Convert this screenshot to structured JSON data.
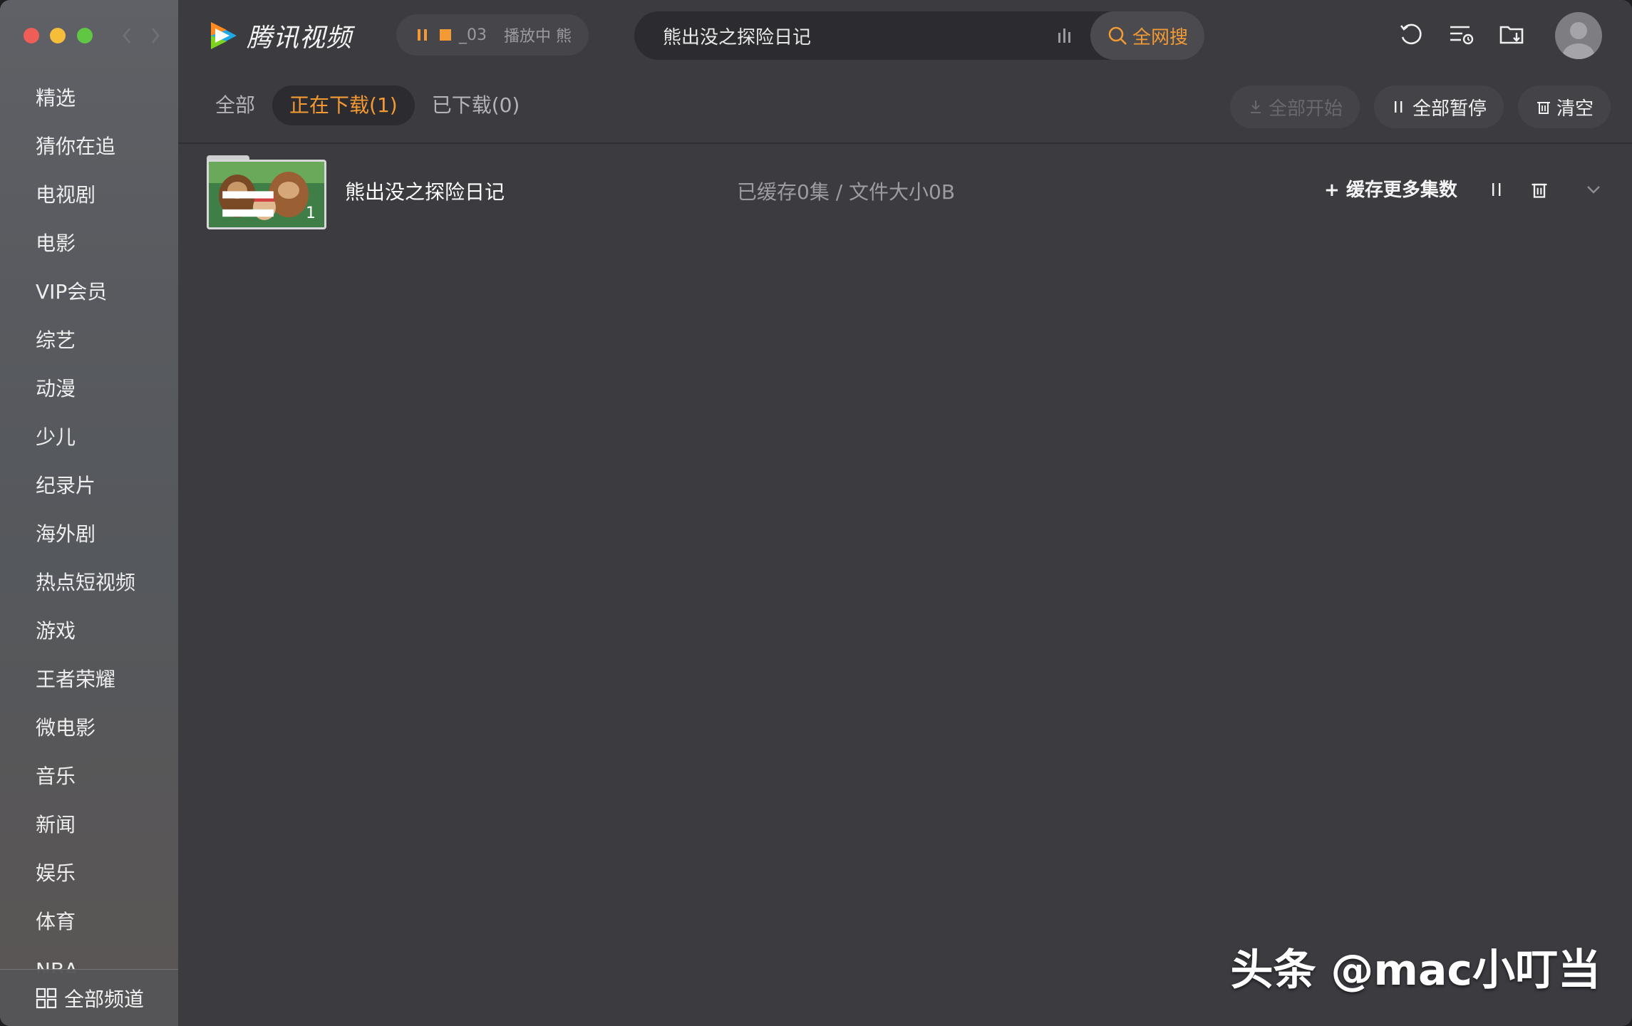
{
  "colors": {
    "accent": "#f39a34",
    "sidebar_bg": "#5b5d61",
    "main_bg": "#3b3b40",
    "traffic_red": "#ee5e57",
    "traffic_yellow": "#f5bd3a",
    "traffic_green": "#5fc744"
  },
  "app": {
    "name": "腾讯视频"
  },
  "sidebar": {
    "items": [
      {
        "label": "精选"
      },
      {
        "label": "猜你在追"
      },
      {
        "label": "电视剧"
      },
      {
        "label": "电影"
      },
      {
        "label": "VIP会员"
      },
      {
        "label": "综艺"
      },
      {
        "label": "动漫"
      },
      {
        "label": "少儿"
      },
      {
        "label": "纪录片"
      },
      {
        "label": "海外剧"
      },
      {
        "label": "热点短视频"
      },
      {
        "label": "游戏"
      },
      {
        "label": "王者荣耀"
      },
      {
        "label": "微电影"
      },
      {
        "label": "音乐"
      },
      {
        "label": "新闻"
      },
      {
        "label": "娱乐"
      },
      {
        "label": "体育"
      },
      {
        "label": "NBA"
      }
    ],
    "footer_label": "全部频道"
  },
  "player": {
    "episode": "_03",
    "status": "播放中 熊"
  },
  "search": {
    "value": "熊出没之探险日记",
    "button_label": "全网搜"
  },
  "tabs": [
    {
      "label": "全部",
      "active": false
    },
    {
      "label": "正在下载(1)",
      "active": true
    },
    {
      "label": "已下载(0)",
      "active": false
    }
  ],
  "actions": {
    "start_all": "全部开始",
    "pause_all": "全部暂停",
    "clear": "清空"
  },
  "downloads": [
    {
      "title": "熊出没之探险日记",
      "status": "已缓存0集 / 文件大小0B",
      "episode_count": "1",
      "more_label": "+ 缓存更多集数"
    }
  ],
  "watermark": "头条 @mac小叮当"
}
